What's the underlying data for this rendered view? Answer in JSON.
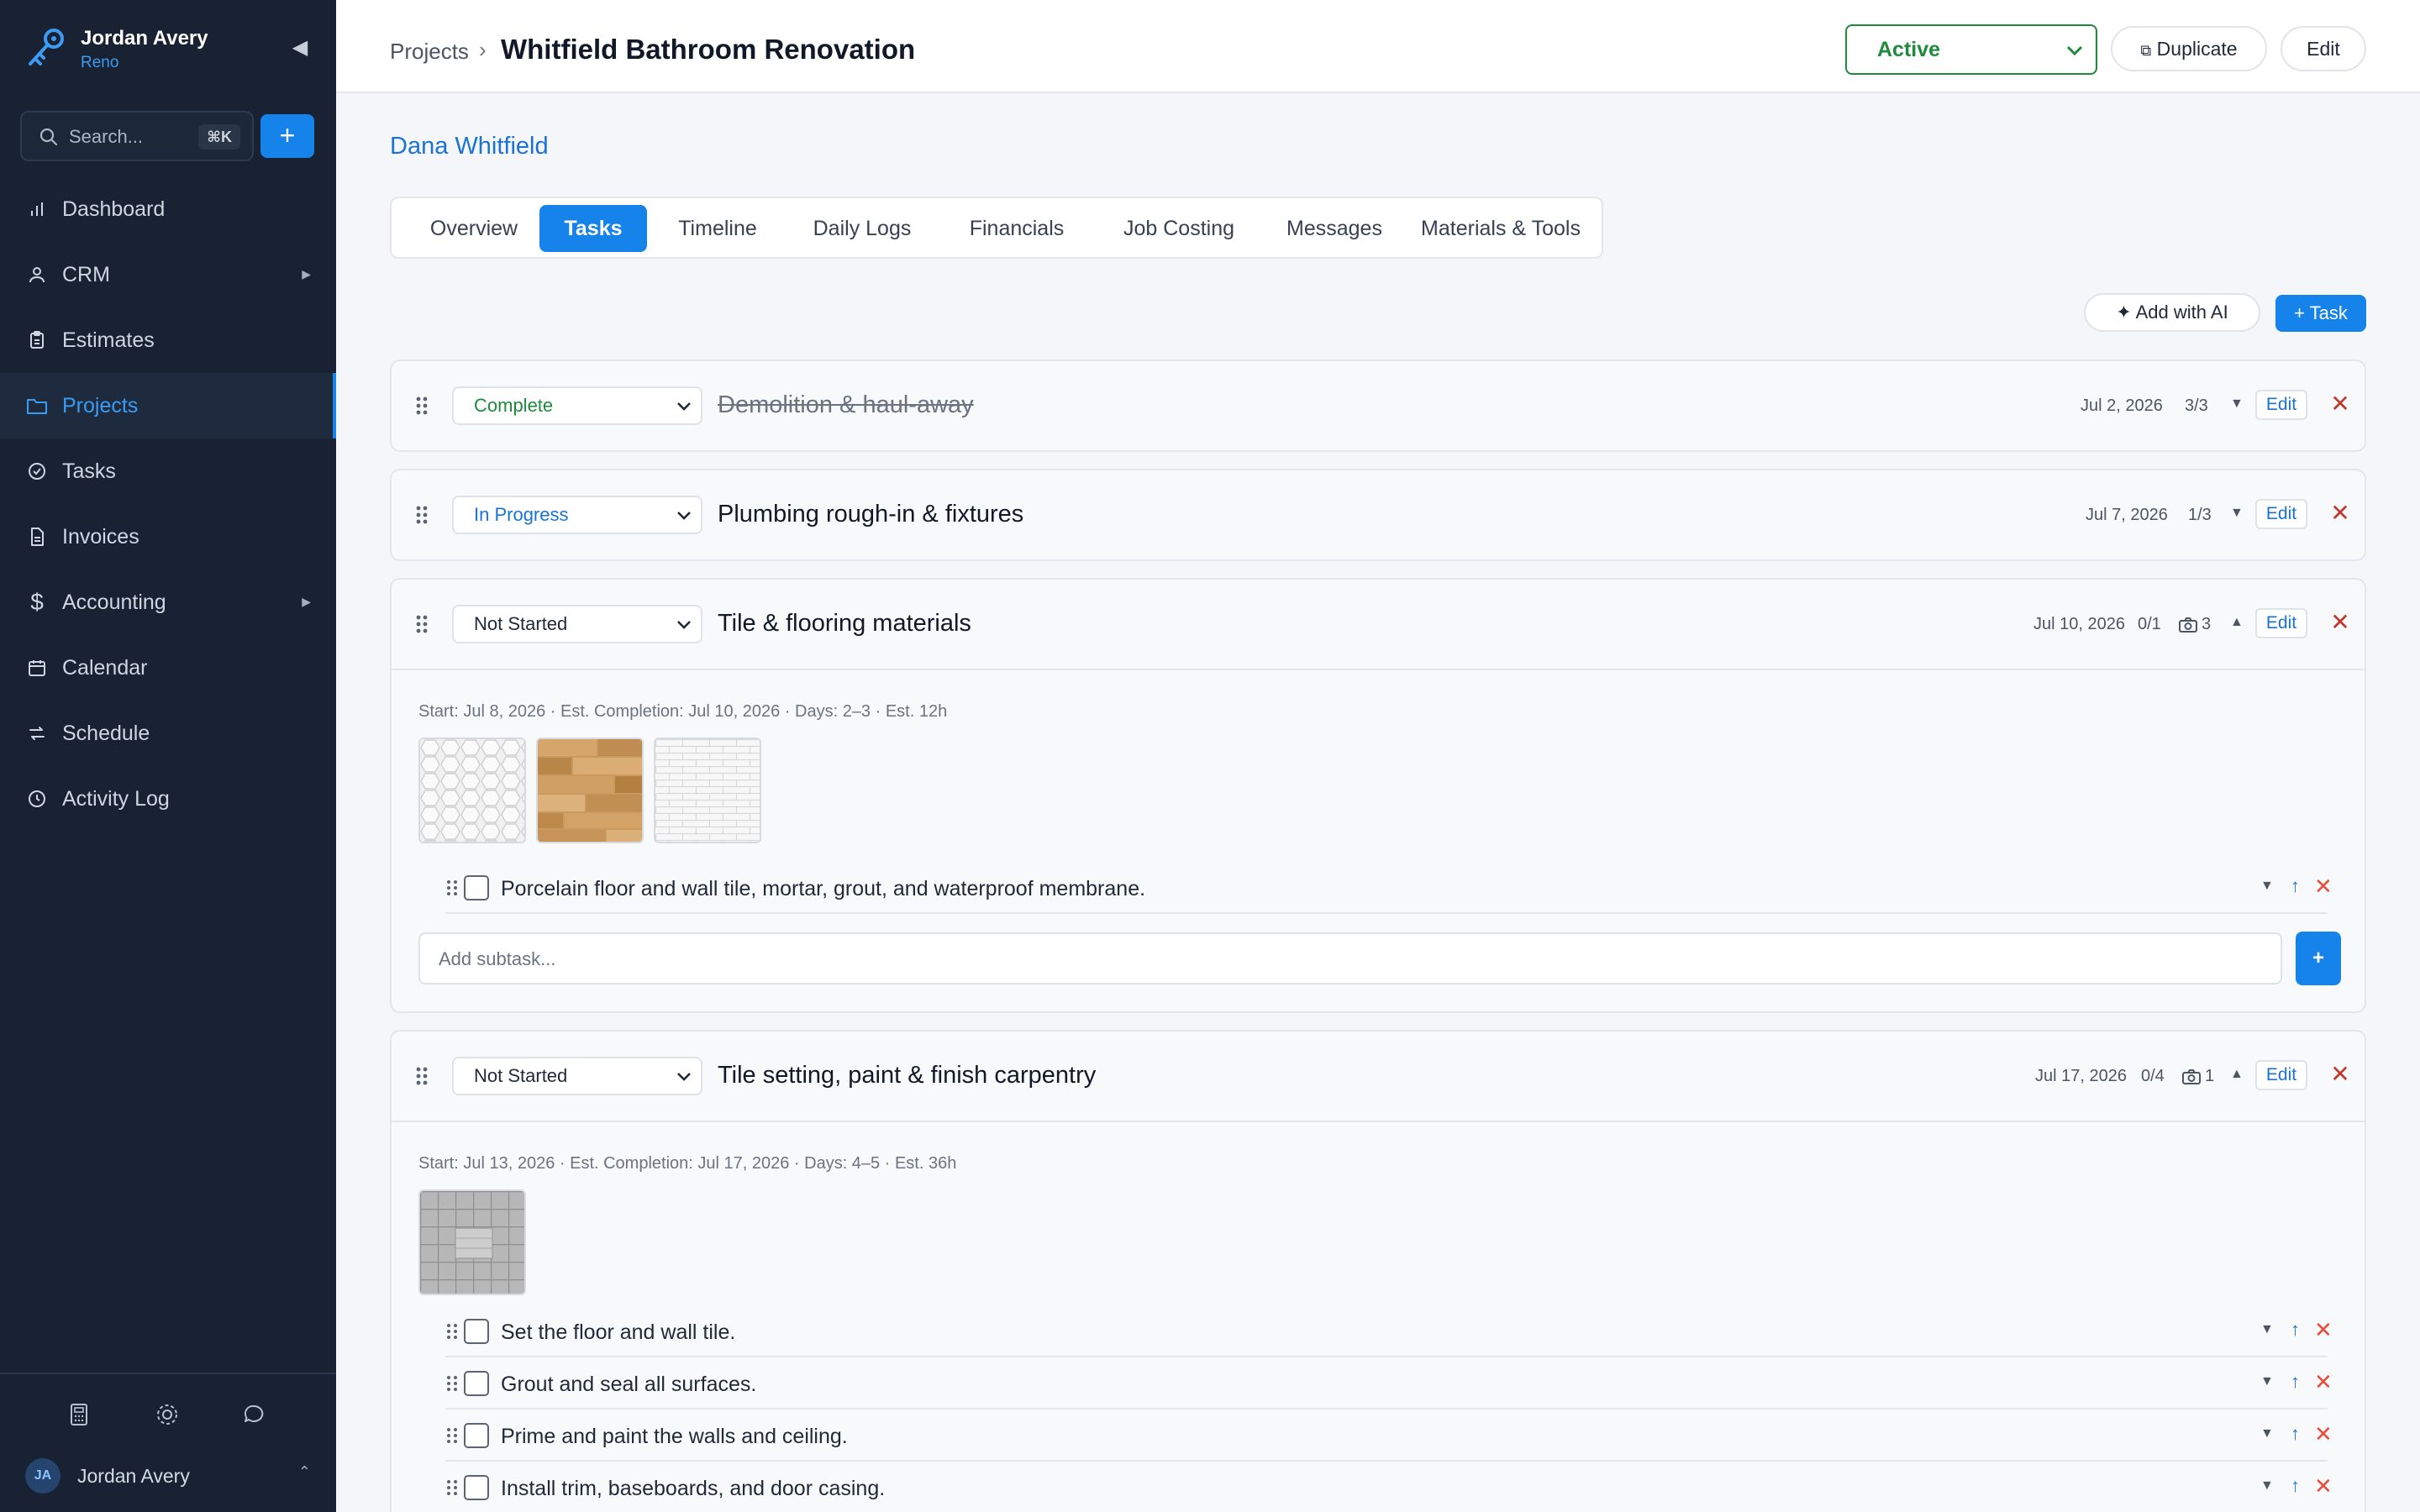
{
  "sidebar": {
    "user_name": "Jordan Avery",
    "app_sub": "Reno",
    "search_placeholder": "Search...",
    "search_shortcut": "⌘K",
    "new_label": "+",
    "items": [
      {
        "label": "Dashboard",
        "icon": "bar-chart-icon"
      },
      {
        "label": "CRM",
        "icon": "person-icon",
        "has_children": true
      },
      {
        "label": "Estimates",
        "icon": "clipboard-icon"
      },
      {
        "label": "Projects",
        "icon": "folder-icon",
        "active": true
      },
      {
        "label": "Tasks",
        "icon": "check-circle-icon"
      },
      {
        "label": "Invoices",
        "icon": "document-icon"
      },
      {
        "label": "Accounting",
        "icon": "dollar-icon",
        "has_children": true
      },
      {
        "label": "Calendar",
        "icon": "calendar-icon"
      },
      {
        "label": "Schedule",
        "icon": "swap-icon"
      },
      {
        "label": "Activity Log",
        "icon": "clock-icon"
      }
    ],
    "footer": {
      "avatar_initials": "JA",
      "user_name": "Jordan Avery"
    }
  },
  "header": {
    "breadcrumb_root": "Projects",
    "breadcrumb_sep": "›",
    "title": "Whitfield Bathroom Renovation",
    "status": "Active",
    "duplicate_label": "Duplicate",
    "edit_label": "Edit"
  },
  "client": "Dana Whitfield",
  "tabs": [
    {
      "label": "Overview"
    },
    {
      "label": "Tasks",
      "active": true
    },
    {
      "label": "Timeline"
    },
    {
      "label": "Daily Logs"
    },
    {
      "label": "Financials"
    },
    {
      "label": "Job Costing"
    },
    {
      "label": "Messages"
    },
    {
      "label": "Materials & Tools"
    }
  ],
  "actions": {
    "add_ai": "Add with AI",
    "add_task": "+ Task"
  },
  "tasks": [
    {
      "status": "Complete",
      "title": "Demolition & haul-away",
      "date": "Jul 2, 2026",
      "progress": "3/3",
      "edit": "Edit"
    },
    {
      "status": "In Progress",
      "title": "Plumbing rough-in & fixtures",
      "date": "Jul 7, 2026",
      "progress": "1/3",
      "edit": "Edit"
    },
    {
      "status": "Not Started",
      "title": "Tile & flooring materials",
      "date": "Jul 10, 2026",
      "progress": "0/1",
      "photos": "3",
      "edit": "Edit",
      "dates_line": "Start: Jul 8, 2026 · Est. Completion: Jul 10, 2026 · Days: 2–3 · Est. 12h",
      "subtasks": [
        "Porcelain floor and wall tile, mortar, grout, and waterproof membrane."
      ],
      "add_placeholder": "Add subtask..."
    },
    {
      "status": "Not Started",
      "title": "Tile setting, paint & finish carpentry",
      "date": "Jul 17, 2026",
      "progress": "0/4",
      "photos": "1",
      "edit": "Edit",
      "dates_line": "Start: Jul 13, 2026 · Est. Completion: Jul 17, 2026 · Days: 4–5 · Est. 36h",
      "subtasks": [
        "Set the floor and wall tile.",
        "Grout and seal all surfaces.",
        "Prime and paint the walls and ceiling.",
        "Install trim, baseboards, and door casing."
      ]
    }
  ],
  "colors": {
    "accent": "#1583e9",
    "success": "#1d8a3c",
    "danger": "#c0392b",
    "sidebar_bg": "#182233"
  }
}
